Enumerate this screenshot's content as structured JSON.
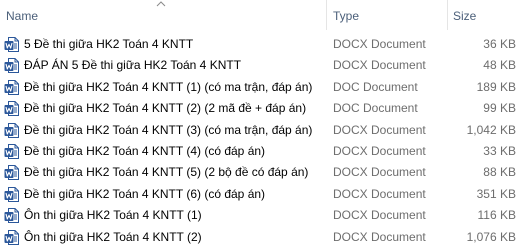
{
  "columns": {
    "name": "Name",
    "type": "Type",
    "size": "Size"
  },
  "icons": {
    "sort": "sort-ascending-icon",
    "file": "word-document-icon"
  },
  "colors": {
    "word_blue": "#2b579a",
    "header_text": "#4c607a",
    "secondary_text": "#6d6d6d"
  },
  "files": [
    {
      "name": "5 Đề thi giữa HK2 Toán 4 KNTT",
      "type": "DOCX Document",
      "size": "36 KB"
    },
    {
      "name": "ĐÁP ÁN 5 Đề thi giữa HK2 Toán 4 KNTT",
      "type": "DOCX Document",
      "size": "48 KB"
    },
    {
      "name": "Đề thi giữa HK2 Toán 4 KNTT (1) (có ma trận, đáp án)",
      "type": "DOC Document",
      "size": "189 KB"
    },
    {
      "name": "Đề thi giữa HK2 Toán 4 KNTT (2) (2 mã đề + đáp án)",
      "type": "DOC Document",
      "size": "99 KB"
    },
    {
      "name": "Đề thi giữa HK2 Toán 4 KNTT (3) (có ma trận, đáp án)",
      "type": "DOCX Document",
      "size": "1,042 KB"
    },
    {
      "name": "Đề thi giữa HK2 Toán 4 KNTT (4) (có đáp án)",
      "type": "DOCX Document",
      "size": "33 KB"
    },
    {
      "name": "Đề thi giữa HK2 Toán 4 KNTT (5) (2 bộ đề có đáp án)",
      "type": "DOCX Document",
      "size": "88 KB"
    },
    {
      "name": "Đề thi giữa HK2 Toán 4 KNTT (6) (có đáp án)",
      "type": "DOCX Document",
      "size": "351 KB"
    },
    {
      "name": "Ôn thi giữa HK2 Toán 4 KNTT (1)",
      "type": "DOCX Document",
      "size": "116 KB"
    },
    {
      "name": "Ôn thi giữa HK2 Toán 4 KNTT (2)",
      "type": "DOCX Document",
      "size": "1,076 KB"
    }
  ]
}
